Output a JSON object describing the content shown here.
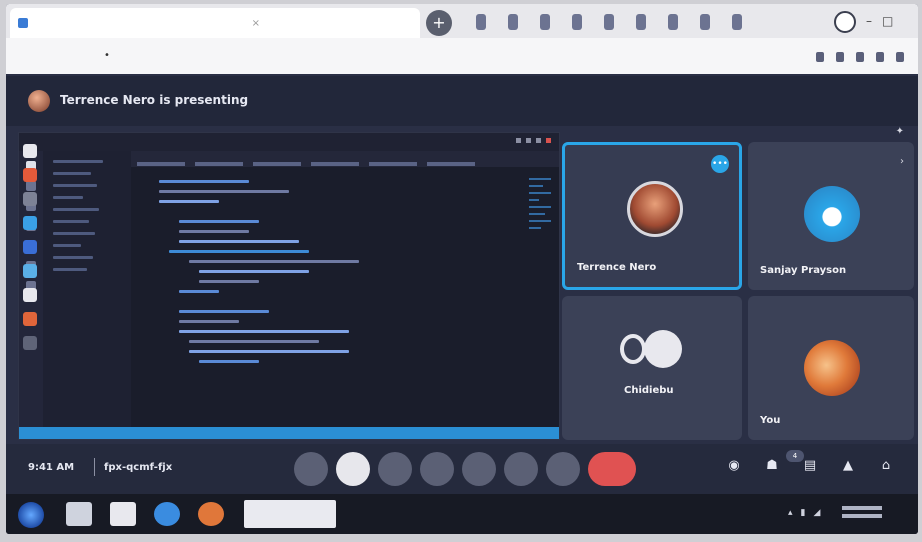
{
  "browser": {
    "new_tab_symbol": "+"
  },
  "meeting": {
    "presenting_text": "Terrence Nero is presenting",
    "clock": "9:41 AM",
    "separator": "|",
    "meeting_code": "fpx-qcmf-fjx"
  },
  "participants": [
    {
      "name": "Terrence Nero",
      "active": true,
      "badge": "•••"
    },
    {
      "name": "Sanjay Prayson",
      "active": false
    },
    {
      "name": "Chidiebu",
      "active": false
    },
    {
      "name": "You",
      "active": false
    }
  ],
  "controls": {
    "end_call_icon": "phone-end-icon",
    "people_count": "4"
  },
  "colors": {
    "accent": "#2aa6e8",
    "end_call": "#e05252",
    "background": "#2a2f45"
  }
}
